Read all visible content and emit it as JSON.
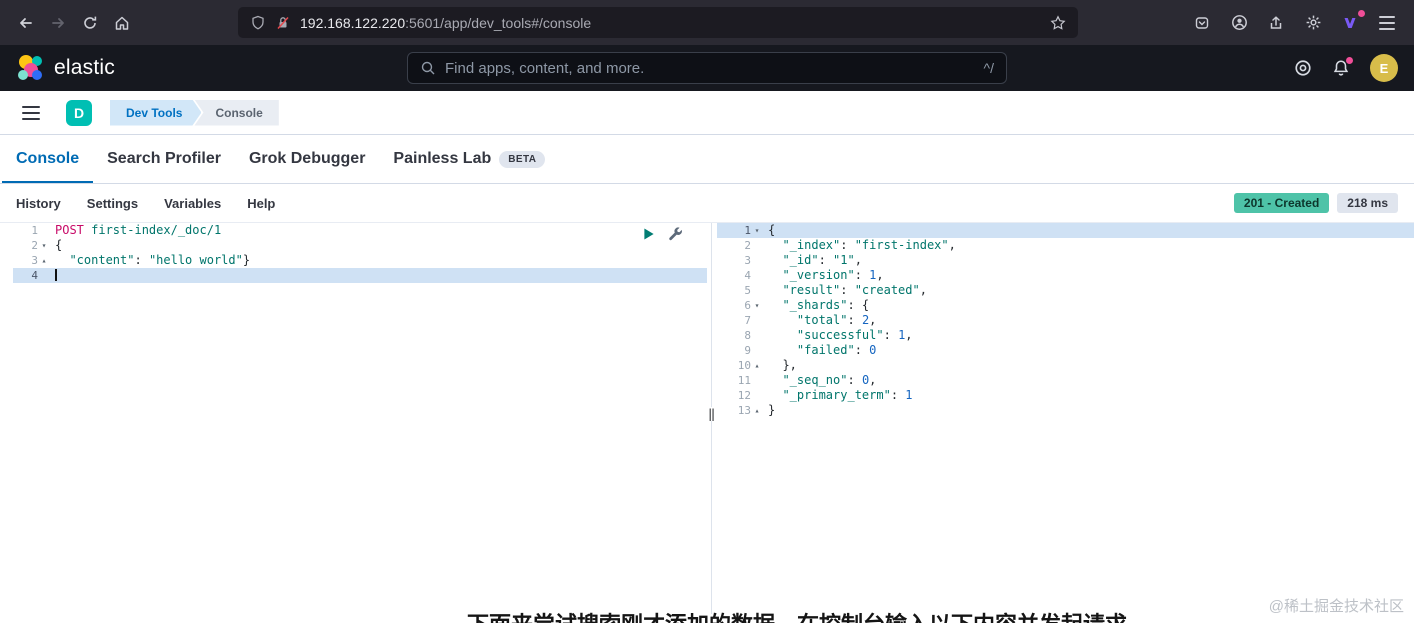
{
  "browser": {
    "url_host": "192.168.122.220",
    "url_path": ":5601/app/dev_tools#/console"
  },
  "header": {
    "brand": "elastic",
    "search_placeholder": "Find apps, content, and more.",
    "search_shortcut": "^/",
    "avatar_letter": "E"
  },
  "nav": {
    "space_letter": "D",
    "breadcrumbs": [
      "Dev Tools",
      "Console"
    ]
  },
  "tabs": [
    {
      "label": "Console",
      "active": true
    },
    {
      "label": "Search Profiler",
      "active": false
    },
    {
      "label": "Grok Debugger",
      "active": false
    },
    {
      "label": "Painless Lab",
      "active": false,
      "badge": "BETA"
    }
  ],
  "toolbar": {
    "links": [
      "History",
      "Settings",
      "Variables",
      "Help"
    ],
    "status_badge": "201 - Created",
    "time_badge": "218 ms"
  },
  "console": {
    "request_lines": [
      {
        "n": 1,
        "segs": [
          [
            "POST ",
            "method"
          ],
          [
            "first-index/_doc/1",
            "url"
          ]
        ]
      },
      {
        "n": 2,
        "fold": "down",
        "segs": [
          [
            "{",
            "p"
          ]
        ]
      },
      {
        "n": 3,
        "fold": "up",
        "segs": [
          [
            "  ",
            "p"
          ],
          [
            "\"content\"",
            "str"
          ],
          [
            ": ",
            "p"
          ],
          [
            "\"hello world\"",
            "str"
          ],
          [
            "}",
            "p"
          ]
        ]
      },
      {
        "n": 4,
        "active": true,
        "caret": true,
        "segs": []
      }
    ],
    "response_lines": [
      {
        "n": 1,
        "active": true,
        "fold": "down",
        "segs": [
          [
            "{",
            "p"
          ]
        ]
      },
      {
        "n": 2,
        "segs": [
          [
            "  ",
            "p"
          ],
          [
            "\"_index\"",
            "str"
          ],
          [
            ": ",
            "p"
          ],
          [
            "\"first-index\"",
            "str"
          ],
          [
            ",",
            "p"
          ]
        ]
      },
      {
        "n": 3,
        "segs": [
          [
            "  ",
            "p"
          ],
          [
            "\"_id\"",
            "str"
          ],
          [
            ": ",
            "p"
          ],
          [
            "\"1\"",
            "str"
          ],
          [
            ",",
            "p"
          ]
        ]
      },
      {
        "n": 4,
        "segs": [
          [
            "  ",
            "p"
          ],
          [
            "\"_version\"",
            "str"
          ],
          [
            ": ",
            "p"
          ],
          [
            "1",
            "num"
          ],
          [
            ",",
            "p"
          ]
        ]
      },
      {
        "n": 5,
        "segs": [
          [
            "  ",
            "p"
          ],
          [
            "\"result\"",
            "str"
          ],
          [
            ": ",
            "p"
          ],
          [
            "\"created\"",
            "str"
          ],
          [
            ",",
            "p"
          ]
        ]
      },
      {
        "n": 6,
        "fold": "down",
        "segs": [
          [
            "  ",
            "p"
          ],
          [
            "\"_shards\"",
            "str"
          ],
          [
            ": {",
            "p"
          ]
        ]
      },
      {
        "n": 7,
        "segs": [
          [
            "    ",
            "p"
          ],
          [
            "\"total\"",
            "str"
          ],
          [
            ": ",
            "p"
          ],
          [
            "2",
            "num"
          ],
          [
            ",",
            "p"
          ]
        ]
      },
      {
        "n": 8,
        "segs": [
          [
            "    ",
            "p"
          ],
          [
            "\"successful\"",
            "str"
          ],
          [
            ": ",
            "p"
          ],
          [
            "1",
            "num"
          ],
          [
            ",",
            "p"
          ]
        ]
      },
      {
        "n": 9,
        "segs": [
          [
            "    ",
            "p"
          ],
          [
            "\"failed\"",
            "str"
          ],
          [
            ": ",
            "p"
          ],
          [
            "0",
            "num"
          ]
        ]
      },
      {
        "n": 10,
        "fold": "up",
        "segs": [
          [
            "  },",
            "p"
          ]
        ]
      },
      {
        "n": 11,
        "segs": [
          [
            "  ",
            "p"
          ],
          [
            "\"_seq_no\"",
            "str"
          ],
          [
            ": ",
            "p"
          ],
          [
            "0",
            "num"
          ],
          [
            ",",
            "p"
          ]
        ]
      },
      {
        "n": 12,
        "segs": [
          [
            "  ",
            "p"
          ],
          [
            "\"_primary_term\"",
            "str"
          ],
          [
            ": ",
            "p"
          ],
          [
            "1",
            "num"
          ]
        ]
      },
      {
        "n": 13,
        "fold": "up",
        "segs": [
          [
            "}",
            "p"
          ]
        ]
      }
    ]
  },
  "footer": {
    "partial_text": "下面来尝试搜索刚才添加的数据，在控制台输入以下内容并发起请求",
    "watermark": "@稀土掘金技术社区"
  },
  "colors": {
    "accent_blue": "#006bb4",
    "status_badge_green": "#4ec3a8",
    "space_badge_teal": "#00bfb3",
    "method_pink": "#c80a68",
    "string_teal": "#00756b",
    "number_blue": "#1565c0",
    "active_line_blue": "#cfe1f4"
  }
}
